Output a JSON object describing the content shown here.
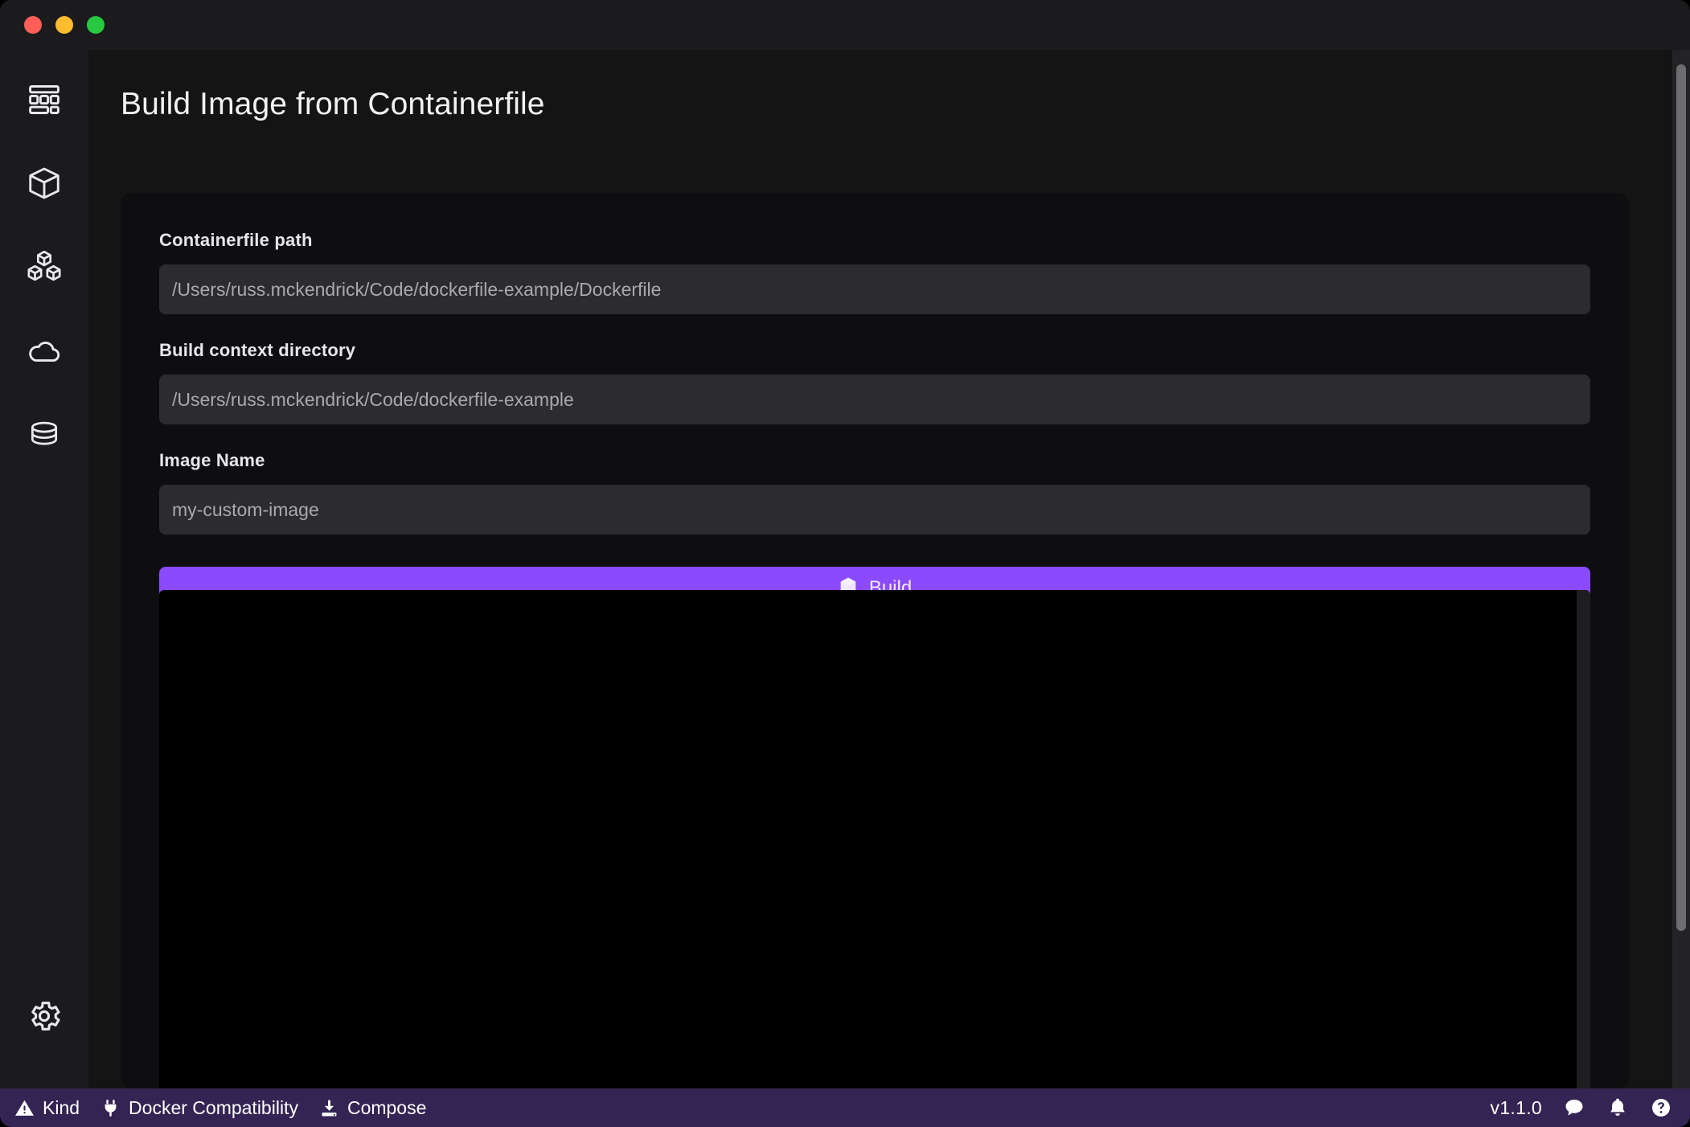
{
  "window": {
    "traffic_lights": [
      {
        "name": "close",
        "color": "#ff5f57"
      },
      {
        "name": "minimize",
        "color": "#febc2e"
      },
      {
        "name": "maximize",
        "color": "#28c840"
      }
    ]
  },
  "sidebar": {
    "items": [
      {
        "icon": "dashboard-icon",
        "label": "Dashboard"
      },
      {
        "icon": "container-box-icon",
        "label": "Containers"
      },
      {
        "icon": "images-stack-icon",
        "label": "Images"
      },
      {
        "icon": "cloud-icon",
        "label": "Pods"
      },
      {
        "icon": "database-icon",
        "label": "Volumes"
      }
    ],
    "bottom": {
      "icon": "gear-icon",
      "label": "Settings"
    }
  },
  "main": {
    "page_title": "Build Image from Containerfile",
    "form": {
      "containerfile": {
        "label": "Containerfile path",
        "value": "",
        "placeholder": "/Users/russ.mckendrick/Code/dockerfile-example/Dockerfile"
      },
      "context": {
        "label": "Build context directory",
        "value": "",
        "placeholder": "/Users/russ.mckendrick/Code/dockerfile-example"
      },
      "image_name": {
        "label": "Image Name",
        "value": "",
        "placeholder": "my-custom-image"
      },
      "build_button": {
        "label": "Build",
        "icon": "cube-icon",
        "color": "#8b4afc"
      }
    },
    "log_output": ""
  },
  "statusbar": {
    "color": "#332453",
    "left_items": [
      {
        "icon": "warning-triangle-icon",
        "label": "Kind"
      },
      {
        "icon": "plug-icon",
        "label": "Docker Compatibility"
      },
      {
        "icon": "download-icon",
        "label": "Compose"
      }
    ],
    "version": "v1.1.0",
    "right_icons": [
      {
        "icon": "chat-bubble-icon",
        "label": "Feedback"
      },
      {
        "icon": "bell-icon",
        "label": "Notifications"
      },
      {
        "icon": "help-circle-icon",
        "label": "Help"
      }
    ]
  }
}
